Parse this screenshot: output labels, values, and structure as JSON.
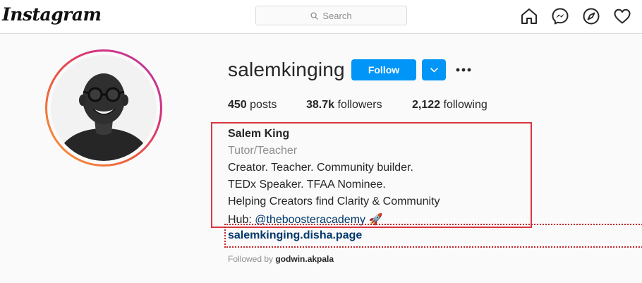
{
  "nav": {
    "logo": "Instagram",
    "search_placeholder": "Search",
    "icons": [
      "home-icon",
      "messenger-icon",
      "explore-icon",
      "activity-heart-icon"
    ]
  },
  "profile": {
    "username": "salemkinging",
    "follow_label": "Follow",
    "stats": {
      "posts_count": "450",
      "posts_label": "posts",
      "followers_count": "38.7k",
      "followers_label": "followers",
      "following_count": "2,122",
      "following_label": "following"
    },
    "bio": {
      "name": "Salem King",
      "category": "Tutor/Teacher",
      "line1": "Creator. Teacher. Community builder.",
      "line2": "TEDx Speaker. TFAA Nominee.",
      "line3": "Helping Creators find Clarity & Community",
      "hub_prefix": "Hub: ",
      "hub_mention": "@theboosteracademy",
      "hub_emoji": "🚀",
      "website": "salemkinging.disha.page",
      "followed_by_prefix": "Followed by ",
      "followed_by_user": "godwin.akpala"
    }
  },
  "colors": {
    "accent": "#0095f6",
    "link": "#00376b",
    "muted": "#8e8e8e",
    "highlight": "#d9363e"
  }
}
